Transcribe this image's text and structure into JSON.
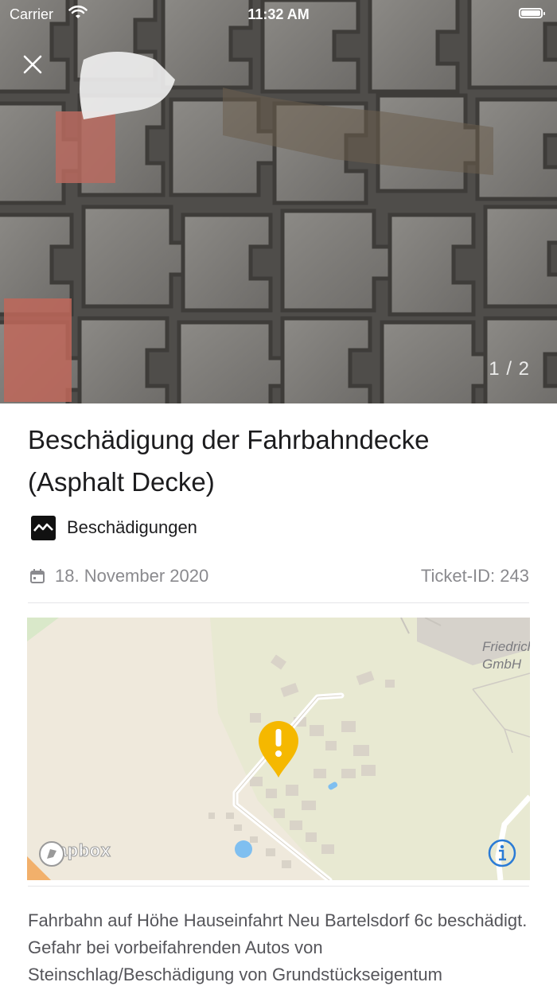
{
  "status_bar": {
    "carrier": "Carrier",
    "time": "11:32 AM"
  },
  "header": {
    "close_icon": "close-icon",
    "photo_counter": "1 / 2"
  },
  "report": {
    "title": "Beschädigung der Fahrbahndecke (Asphalt Decke)",
    "category": {
      "icon": "damage-icon",
      "label": "Beschädigungen"
    },
    "date": "18. November 2020",
    "ticket_id": "Ticket-ID: 243",
    "description": "Fahrbahn auf Höhe Hauseinfahrt Neu Bartelsdorf 6c beschädigt. Gefahr bei vorbeifahrenden Autos von Steinschlag/Beschädigung von Grundstückseigentum"
  },
  "map": {
    "poi_label_line1": "Friedrich",
    "poi_label_line2": "GmbH",
    "attribution": "mapbox",
    "marker_icon": "warning-marker-icon",
    "info_icon": "info-icon"
  },
  "colors": {
    "marker": "#f5b800",
    "info_accent": "#2a7bd6",
    "map_background": "#efe9dc",
    "water": "#7fbff0"
  }
}
